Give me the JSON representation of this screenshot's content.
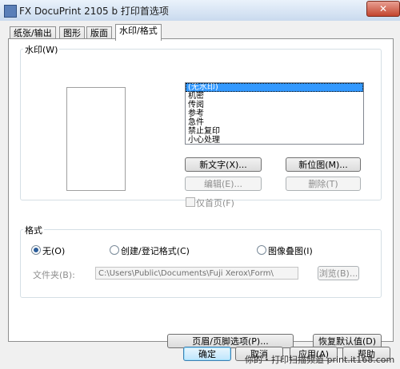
{
  "window": {
    "title": "FX DocuPrint 2105 b 打印首选项",
    "close_symbol": "✕"
  },
  "tabs": [
    {
      "label": "纸张/输出"
    },
    {
      "label": "图形"
    },
    {
      "label": "版面"
    },
    {
      "label": "水印/格式",
      "active": true
    }
  ],
  "watermark": {
    "group_label": "水印(W)",
    "list_items": [
      "(无水印)",
      "机密",
      "传阅",
      "参考",
      "急件",
      "禁止复印",
      "小心处理"
    ],
    "selected_index": 0,
    "new_text_button": "新文字(X)...",
    "new_bitmap_button": "新位图(M)...",
    "edit_button": "编辑(E)...",
    "delete_button": "删除(T)",
    "first_page_only_label": "仅首页(F)",
    "first_page_only_checked": false
  },
  "format": {
    "group_label": "格式",
    "options": [
      {
        "label": "无(O)",
        "checked": true
      },
      {
        "label": "创建/登记格式(C)",
        "checked": false
      },
      {
        "label": "图像叠图(I)",
        "checked": false
      }
    ],
    "folder_label": "文件夹(B):",
    "folder_path": "C:\\Users\\Public\\Documents\\Fuji Xerox\\Form\\",
    "browse_button": "浏览(B)..."
  },
  "footer": {
    "header_footer_button": "页眉/页脚选项(P)...",
    "restore_defaults_button": "恢复默认值(D)"
  },
  "dialog_buttons": {
    "ok": "确定",
    "cancel": "取消",
    "apply": "应用(A)",
    "help": "帮助"
  },
  "site_watermark": "你的・打印扫描频道 print.it168.com"
}
